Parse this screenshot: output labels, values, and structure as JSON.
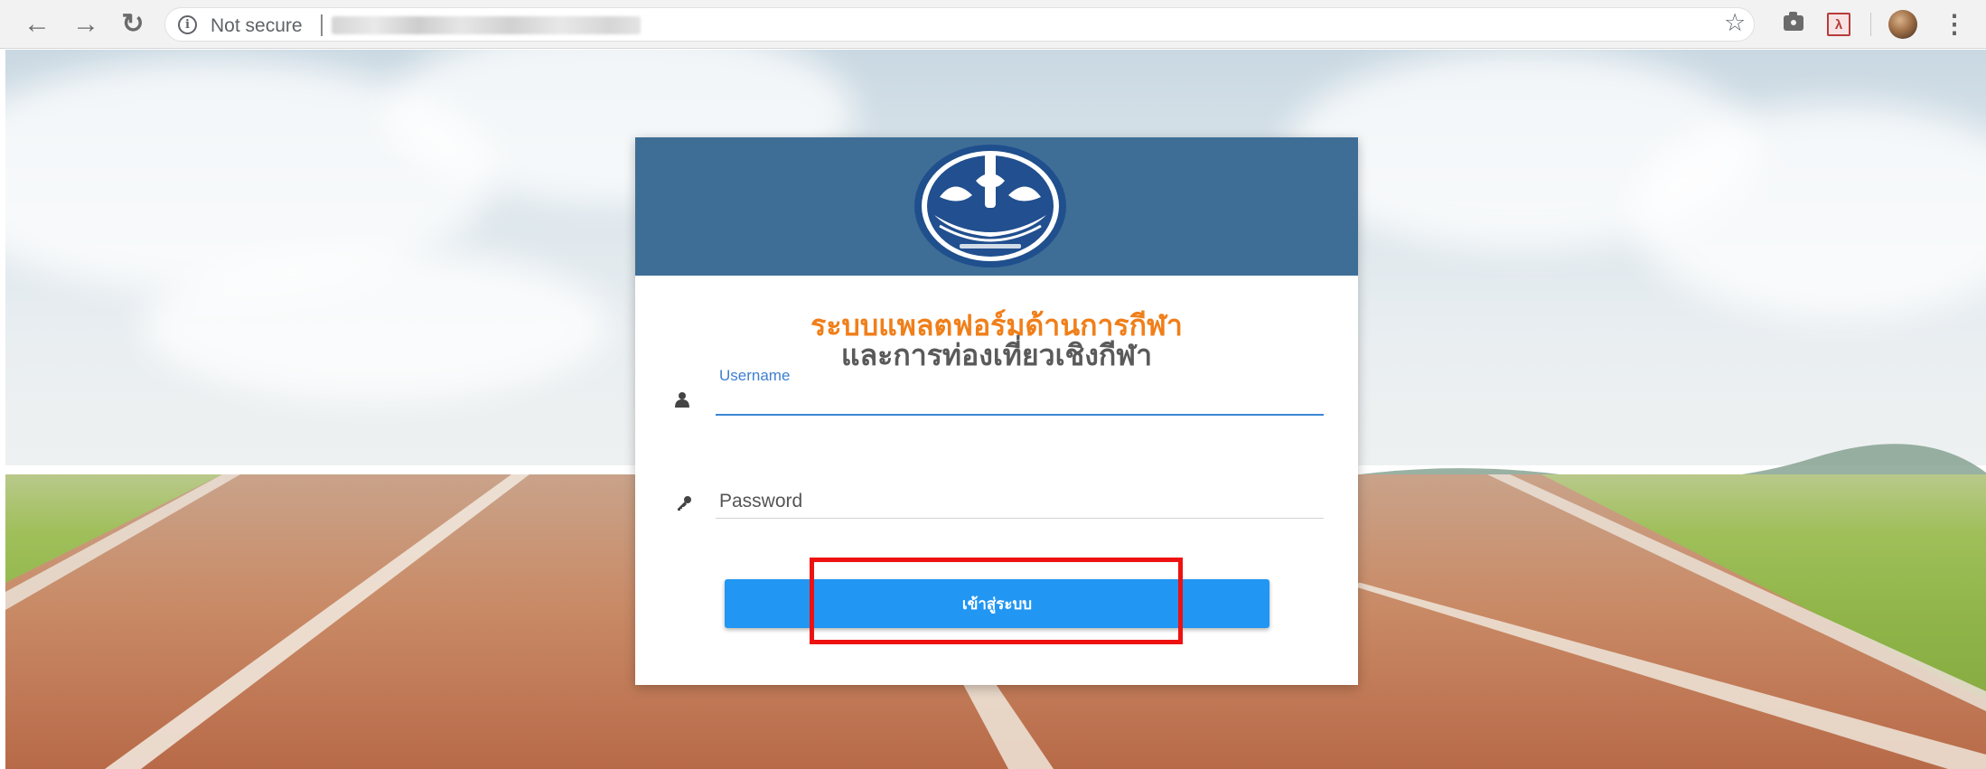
{
  "browser": {
    "security_label": "Not secure",
    "icons": {
      "back": "arrow-left-icon",
      "forward": "arrow-right-icon",
      "reload": "reload-icon",
      "info": "info-icon",
      "bookmark": "star-icon",
      "camera": "camera-icon",
      "pdf": "pdf-icon",
      "menu": "kebab-menu-icon"
    }
  },
  "login": {
    "title": "ระบบแพลตฟอร์มด้านการกีฬา",
    "subtitle": "และการท่องเที่ยวเชิงกีฬา",
    "username_label": "Username",
    "username_value": "",
    "password_placeholder": "Password",
    "password_value": "",
    "button_label": "เข้าสู่ระบบ",
    "icons": {
      "username": "user-icon",
      "password": "key-icon",
      "logo": "government-seal-icon"
    }
  },
  "colors": {
    "header_bg": "#3e6e96",
    "title": "#f07f1a",
    "subtitle": "#5a5a5a",
    "accent": "#2196f3",
    "highlight": "#ee1111"
  }
}
